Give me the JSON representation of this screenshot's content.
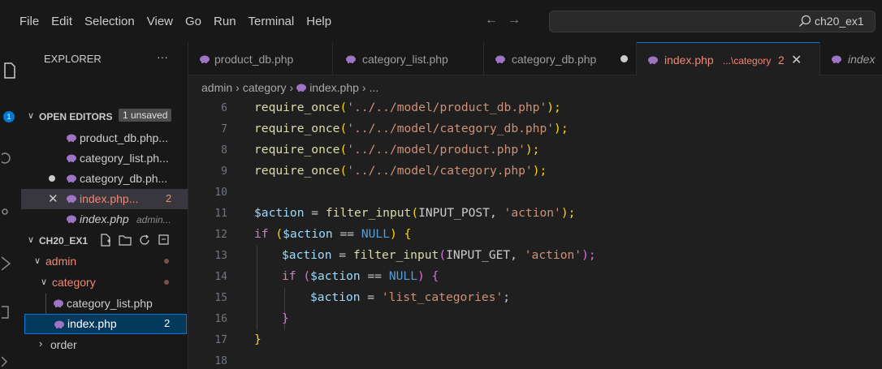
{
  "menu": [
    "File",
    "Edit",
    "Selection",
    "View",
    "Go",
    "Run",
    "Terminal",
    "Help"
  ],
  "search": {
    "text": "ch20_ex1"
  },
  "activity_bar": {
    "badge": "1"
  },
  "explorer": {
    "title": "EXPLORER",
    "more": "···",
    "open_editors": {
      "title": "OPEN EDITORS",
      "badge": "1 unsaved",
      "items": [
        {
          "label": "product_db.php..."
        },
        {
          "label": "category_list.ph..."
        },
        {
          "label": "category_db.ph..."
        },
        {
          "label": "index.php...",
          "errors": "2"
        },
        {
          "label": "index.php",
          "desc": "admin..."
        }
      ]
    },
    "folder": {
      "title": "CH20_EX1",
      "items": [
        {
          "label": "admin"
        },
        {
          "label": "category"
        },
        {
          "label": "category_list.php"
        },
        {
          "label": "index.php",
          "errors": "2"
        },
        {
          "label": "order"
        }
      ]
    }
  },
  "tabs": [
    {
      "label": "product_db.php"
    },
    {
      "label": "category_list.php"
    },
    {
      "label": "category_db.php"
    },
    {
      "label": "index.php",
      "desc": "...\\category",
      "errors": "2"
    },
    {
      "label": "index"
    }
  ],
  "breadcrumb": [
    "admin",
    "category",
    "index.php",
    "..."
  ],
  "editor": {
    "line_numbers": [
      "6",
      "7",
      "8",
      "9",
      "10",
      "11",
      "12",
      "13",
      "14",
      "15",
      "16",
      "17",
      "18"
    ],
    "lines": {
      "l6": {
        "fn": "require_once",
        "open": "(",
        "str": "'../../model/product_db.php'",
        "close": ");"
      },
      "l7": {
        "fn": "require_once",
        "open": "(",
        "str": "'../../model/category_db.php'",
        "close": ");"
      },
      "l8": {
        "fn": "require_once",
        "open": "(",
        "str": "'../../model/product.php'",
        "close": ");"
      },
      "l9": {
        "fn": "require_once",
        "open": "(",
        "str": "'../../model/category.php'",
        "close": ");"
      },
      "l11": {
        "var": "$action",
        "eq": " = ",
        "fn": "filter_input",
        "open": "(",
        "arg": "INPUT_POST, ",
        "str": "'action'",
        "close": ");"
      },
      "l12": {
        "kw": "if",
        "sp": " ",
        "open": "(",
        "var": "$action",
        "op": " == ",
        "cst": "NULL",
        "close": ")",
        "brace": " {"
      },
      "l13": {
        "var": "$action",
        "eq": " = ",
        "fn": "filter_input",
        "open": "(",
        "arg": "INPUT_GET, ",
        "str": "'action'",
        "close": ");"
      },
      "l14": {
        "kw": "if",
        "sp": " ",
        "open": "(",
        "var": "$action",
        "op": " == ",
        "cst": "NULL",
        "close": ")",
        "brace": " {"
      },
      "l15": {
        "var": "$action",
        "eq": " = ",
        "str": "'list_categories'",
        "semi": ";"
      },
      "l16": {
        "brace": "}"
      },
      "l17": {
        "brace": "}"
      }
    }
  },
  "colors": {
    "accent": "#0078d4",
    "string": "#ce9178",
    "function": "#dcdcaa",
    "variable": "#9cdcfe",
    "keyword": "#c586c0",
    "constant": "#569cd6",
    "error": "#f48771"
  },
  "icons": [
    "search-icon",
    "php-file-icon",
    "new-file-icon",
    "new-folder-icon",
    "refresh-icon",
    "collapse-all-icon",
    "close-icon",
    "modified-dot-icon",
    "chevron-down-icon",
    "chevron-right-icon",
    "arrow-left-icon",
    "arrow-right-icon"
  ]
}
